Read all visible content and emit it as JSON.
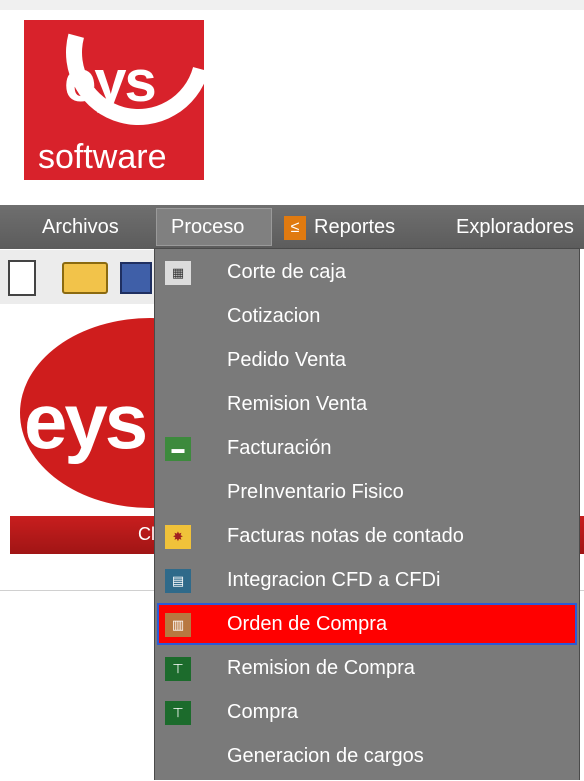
{
  "logo": {
    "word": "eys",
    "sub": "software",
    "color": "#d8222b"
  },
  "menubar": {
    "items": [
      {
        "label": "Archivos"
      },
      {
        "label": "Proceso"
      },
      {
        "label": "Reportes",
        "icon": "report-icon"
      },
      {
        "label": "Exploradores"
      }
    ]
  },
  "toolbar": {
    "icons": [
      "new-document-icon",
      "open-folder-icon",
      "save-icon"
    ]
  },
  "main": {
    "big_logo": "eys",
    "banner_text": "Cla"
  },
  "dropdown": {
    "items": [
      {
        "label": "Corte de caja",
        "icon": "calculator-icon"
      },
      {
        "label": "Cotizacion"
      },
      {
        "label": "Pedido Venta"
      },
      {
        "label": "Remision Venta"
      },
      {
        "label": "Facturación",
        "icon": "truck-icon"
      },
      {
        "label": "PreInventario Fisico"
      },
      {
        "label": "Facturas notas de contado",
        "icon": "seal-icon"
      },
      {
        "label": "Integracion CFD a CFDi",
        "icon": "document-convert-icon"
      },
      {
        "label": "Orden de Compra",
        "icon": "clipboard-icon",
        "selected": true
      },
      {
        "label": "Remision de Compra",
        "icon": "cart-icon"
      },
      {
        "label": "Compra",
        "icon": "cart-icon"
      },
      {
        "label": "Generacion de cargos"
      }
    ]
  },
  "colors": {
    "menubar": "#666666",
    "dropdown_bg": "#7a7a7a",
    "selected": "#ff0000",
    "selected_border": "#2b5bd7",
    "banner": "#c81e1e"
  }
}
